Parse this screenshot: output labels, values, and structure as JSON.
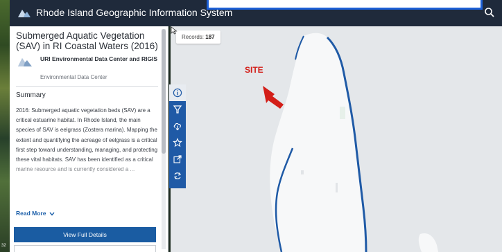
{
  "app": {
    "title": "Rhode Island Geographic Information System"
  },
  "panel": {
    "title": "Submerged Aquatic Vegetation (SAV) in RI Coastal Waters (2016)",
    "source": "URI Environmental Data Center and RIGIS",
    "source_sub": "Environmental Data Center",
    "summary_heading": "Summary",
    "summary_text": "2016: Submerged aquatic vegetation beds (SAV) are a critical estuarine habitat. In Rhode Island, the main species of SAV is eelgrass (Zostera marina). Mapping the extent and quantifying the acreage of eelgrass is a critical first step toward understanding, managing, and protecting these vital habitats. SAV has been identified as a critical marine resource and is currently considered a ...",
    "read_more": "Read More",
    "view_button": "View Full Details"
  },
  "map": {
    "records_label": "Records:",
    "records_count": "187",
    "site_label": "SITE"
  },
  "tools": [
    "info-icon",
    "filter-icon",
    "download-icon",
    "star-icon",
    "share-icon",
    "refresh-icon"
  ],
  "colors": {
    "header": "#1f2a3b",
    "accent": "#1f5aa6",
    "site": "#d31e18",
    "shoreline": "#1f5aa6"
  },
  "corner": "32"
}
